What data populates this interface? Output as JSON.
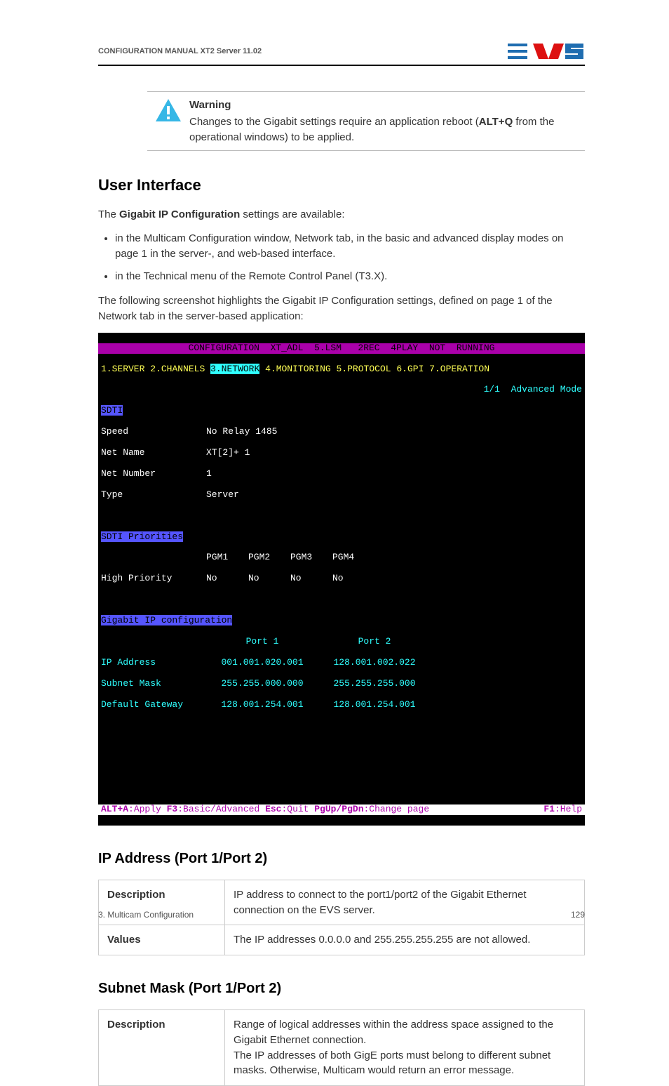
{
  "header": {
    "title": "CONFIGURATION MANUAL XT2 Server 11.02"
  },
  "warning": {
    "label": "Warning",
    "body_prefix": "Changes to the Gigabit settings require an application reboot (",
    "body_bold": "ALT+Q",
    "body_suffix": " from the operational windows) to be applied."
  },
  "ui_section": {
    "heading": "User Interface",
    "intro_prefix": "The ",
    "intro_bold": "Gigabit IP Configuration",
    "intro_suffix": " settings are available:",
    "bullet1": "in the Multicam Configuration window, Network tab, in the basic and advanced display modes on page 1 in the server-, and web-based interface.",
    "bullet2": "in the Technical menu of the Remote Control Panel (T3.X).",
    "post": "The following screenshot highlights the  Gigabit IP Configuration settings, defined on page 1 of the Network tab in the server-based application:"
  },
  "terminal": {
    "title_line": "CONFIGURATION  XT_ADL  5.LSM   2REC  4PLAY  NOT  RUNNING",
    "tabs": {
      "t1": "1.SERVER",
      "t2": "2.CHANNELS",
      "t3": "3.NETWORK",
      "t4": "4.MONITORING",
      "t5": "5.PROTOCOL",
      "t6": "6.GPI",
      "t7": "7.OPERATION"
    },
    "mode_line": "1/1  Advanced Mode",
    "sdti_label": "SDTI",
    "rows": {
      "speed_label": "Speed",
      "speed_value": "No Relay 1485",
      "netname_label": "Net Name",
      "netname_value": "XT[2]+ 1",
      "netnum_label": "Net Number",
      "netnum_value": "1",
      "type_label": "Type",
      "type_value": "Server"
    },
    "prio_label": "SDTI Priorities",
    "pgm": {
      "p1": "PGM1",
      "p2": "PGM2",
      "p3": "PGM3",
      "p4": "PGM4"
    },
    "hp_label": "High Priority",
    "hp_vals": {
      "v1": "No",
      "v2": "No",
      "v3": "No",
      "v4": "No"
    },
    "gigabit_label": "Gigabit IP configuration",
    "port1_label": "Port 1",
    "port2_label": "Port 2",
    "ip_label": "IP Address",
    "ip_p1": "001.001.020.001",
    "ip_p2": "128.001.002.022",
    "mask_label": "Subnet Mask",
    "mask_p1": "255.255.000.000",
    "mask_p2": "255.255.255.000",
    "gw_label": "Default Gateway",
    "gw_p1": "128.001.254.001",
    "gw_p2": "128.001.254.001",
    "footer": {
      "k1": "ALT+A",
      "v1": ":Apply ",
      "k2": "F3",
      "v2": ":Basic/Advanced ",
      "k3": "Esc",
      "v3": ":Quit ",
      "k4": "PgUp/PgDn",
      "v4": ":Change page",
      "k5": "F1",
      "v5": ":Help"
    }
  },
  "ip_section": {
    "heading": "IP Address (Port 1/Port 2)",
    "desc_label": "Description",
    "desc_value": "IP address to connect to the port1/port2 of the Gigabit Ethernet connection on the EVS server.",
    "values_label": "Values",
    "values_value": "The IP addresses 0.0.0.0 and 255.255.255.255 are not allowed."
  },
  "subnet_section": {
    "heading": "Subnet Mask (Port 1/Port 2)",
    "desc_label": "Description",
    "desc_value": "Range of logical addresses within the address space assigned to the Gigabit Ethernet connection.\nThe IP addresses of both GigE ports must belong to different subnet masks. Otherwise, Multicam would return an error message."
  },
  "footer": {
    "left": "3. Multicam Configuration",
    "right": "129"
  }
}
